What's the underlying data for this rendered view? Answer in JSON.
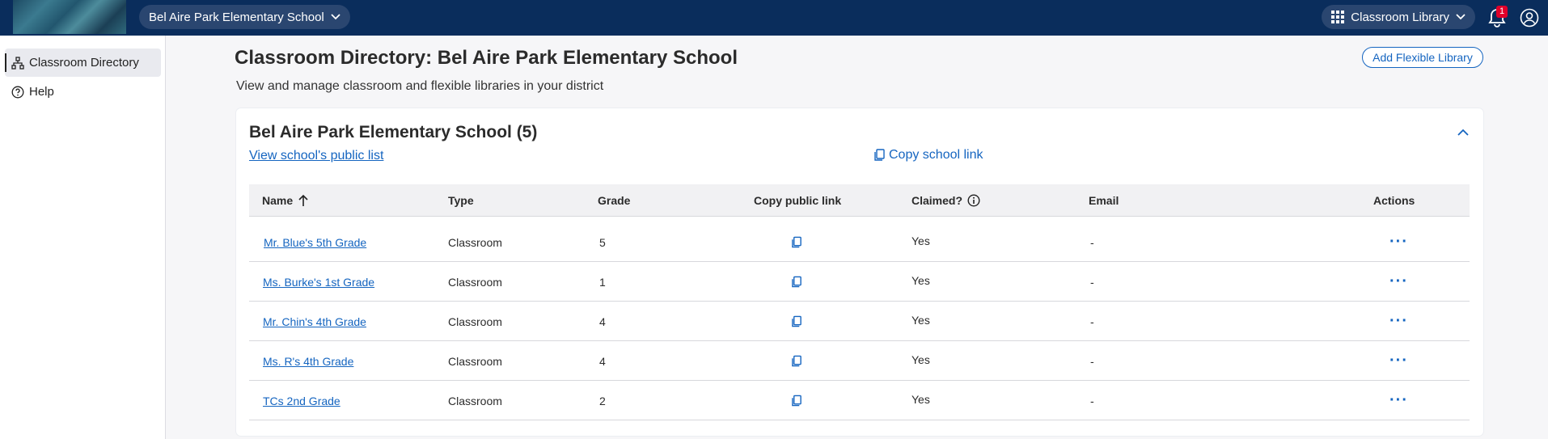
{
  "topbar": {
    "school_selector": "Bel Aire Park Elementary School",
    "app_selector": "Classroom Library",
    "notification_count": "1"
  },
  "sidebar": {
    "items": [
      {
        "label": "Classroom Directory",
        "icon": "org-chart-icon",
        "active": true
      },
      {
        "label": "Help",
        "icon": "help-circle-icon",
        "active": false
      }
    ]
  },
  "header": {
    "title": "Classroom Directory: Bel Aire Park Elementary School",
    "subtitle": "View and manage classroom and flexible libraries in your district",
    "add_button": "Add Flexible Library"
  },
  "school_card": {
    "title": "Bel Aire Park Elementary School (5)",
    "public_list_link": "View school's public list",
    "copy_school_link": "Copy school link"
  },
  "table": {
    "columns": [
      "Name",
      "Type",
      "Grade",
      "Copy public link",
      "Claimed?",
      "Email",
      "Actions"
    ],
    "rows": [
      {
        "name": "Mr. Blue's 5th Grade",
        "type": "Classroom",
        "grade": "5",
        "claimed": "Yes",
        "email": "-"
      },
      {
        "name": "Ms. Burke's 1st Grade",
        "type": "Classroom",
        "grade": "1",
        "claimed": "Yes",
        "email": "-"
      },
      {
        "name": "Mr. Chin's 4th Grade",
        "type": "Classroom",
        "grade": "4",
        "claimed": "Yes",
        "email": "-"
      },
      {
        "name": "Ms. R's 4th Grade",
        "type": "Classroom",
        "grade": "4",
        "claimed": "Yes",
        "email": "-"
      },
      {
        "name": "TCs 2nd Grade",
        "type": "Classroom",
        "grade": "2",
        "claimed": "Yes",
        "email": "-"
      }
    ],
    "actions_label": "···"
  },
  "colors": {
    "topbar": "#0a2d5c",
    "link": "#1565c0",
    "badge": "#e0002a"
  }
}
